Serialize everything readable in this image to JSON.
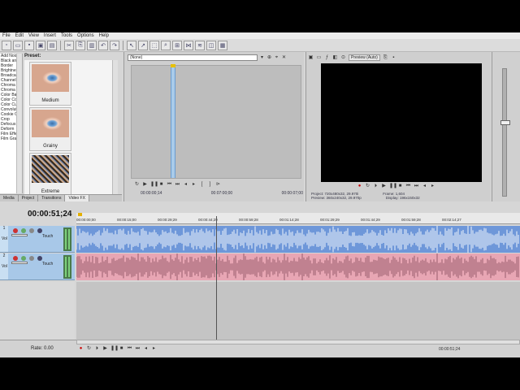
{
  "menu": [
    "File",
    "Edit",
    "View",
    "Insert",
    "Tools",
    "Options",
    "Help"
  ],
  "left_list": [
    "Add Noise",
    "Black and",
    "Border",
    "Brightness",
    "Broadcast",
    "Channel Blend",
    "Chroma Blur",
    "Chroma Keyer",
    "Color Balance",
    "Color Corrector",
    "Color Curves",
    "Convolution",
    "Cookie Cutter",
    "Crop",
    "Defocus",
    "Deform",
    "Film Effects",
    "Film Grain"
  ],
  "preset_label": "Preset:",
  "fx_presets": [
    {
      "label": "Medium",
      "image": "eye-image"
    },
    {
      "label": "Grainy",
      "image": "eye-image"
    },
    {
      "label": "Extreme",
      "image": "noise-eye-image"
    }
  ],
  "left_tabs": [
    "Media",
    "Project",
    "Transitions",
    "Video FX"
  ],
  "trimmer": {
    "select_value": "(None)",
    "time_start": "00:00:00;14",
    "time_len": "00:07:00;00",
    "time_end": "00:00:07;00"
  },
  "preview": {
    "quality": "Preview (Auto)",
    "project": "Project: 720x480x32, 29.970i",
    "preview_res": "Preview: 360x240x32, 29.970p",
    "frame": "Frame: 1,604",
    "display": "Display: 196x150x32"
  },
  "timeline": {
    "timecode": "00:00:51;24",
    "ruler_ticks": [
      "00:00:00;00",
      "00:00:15;00",
      "00:00:29;29",
      "00:00:44;29",
      "00:00:59;28",
      "00:01:14;28",
      "00:01:29;29",
      "00:01:44;29",
      "00:01:59;28",
      "00:02:14;27"
    ],
    "tracks": [
      {
        "number": "1",
        "name": "Vol",
        "mode": "Touch",
        "color": "#6e97d9"
      },
      {
        "number": "2",
        "name": "Vol",
        "mode": "Touch",
        "color": "#e8a6b4"
      }
    ],
    "rate": "Rate: 0.00",
    "bottom_time": "00:00:51;24"
  }
}
